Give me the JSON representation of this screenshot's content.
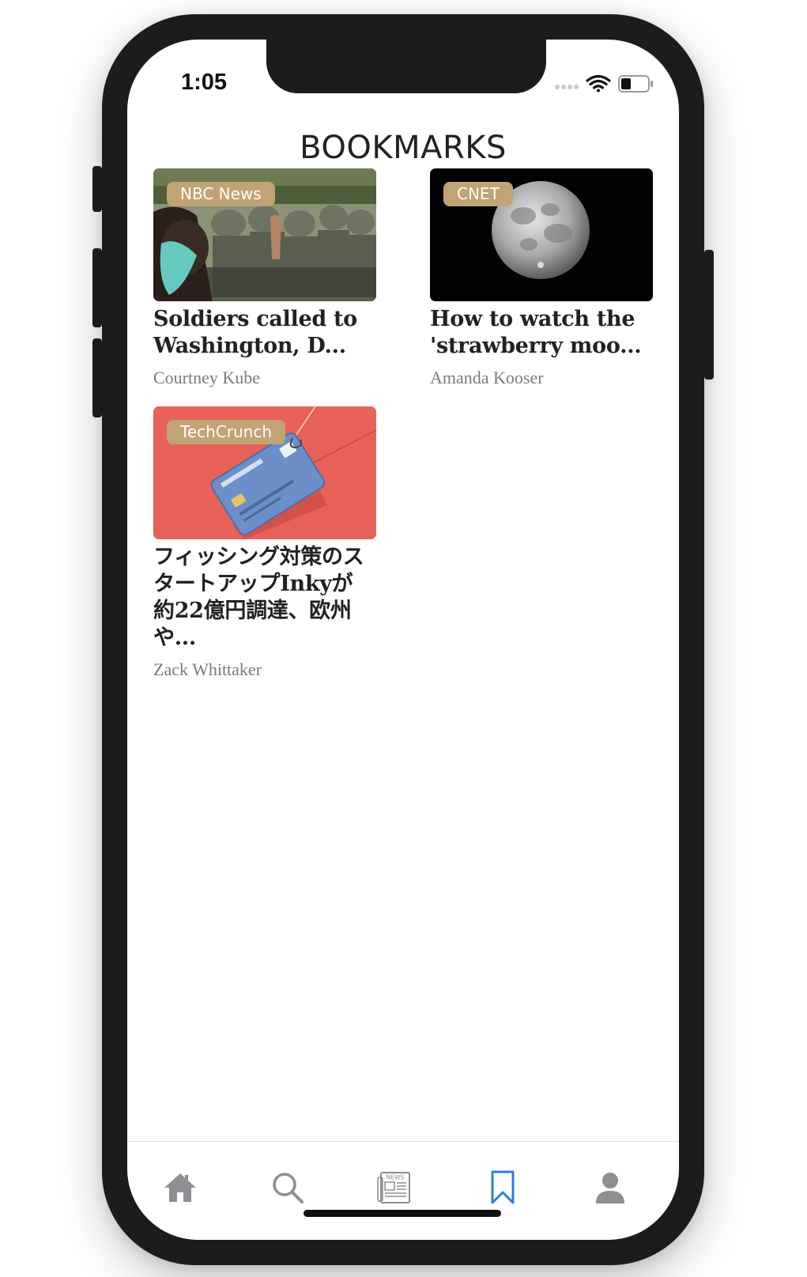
{
  "status_bar": {
    "time": "1:05"
  },
  "header": {
    "title": "BOOKMARKS"
  },
  "bookmarks": [
    {
      "source": "NBC News",
      "title": "Soldiers called to Washington, D...",
      "author": "Courtney Kube",
      "image": "protest-photo"
    },
    {
      "source": "CNET",
      "title": "How to watch the 'strawberry moo...",
      "author": "Amanda Kooser",
      "image": "moon-photo"
    },
    {
      "source": "TechCrunch",
      "title": "フィッシング対策のスタートアップInkyが約22億円調達、欧州や...",
      "author": "Zack Whittaker",
      "image": "credit-card-on-hook-illustration"
    }
  ],
  "tabbar": {
    "items": [
      {
        "name": "home",
        "icon": "home-icon",
        "active": false
      },
      {
        "name": "search",
        "icon": "search-icon",
        "active": false
      },
      {
        "name": "news",
        "icon": "newspaper-icon",
        "active": false
      },
      {
        "name": "bookmarks",
        "icon": "bookmark-icon",
        "active": true
      },
      {
        "name": "profile",
        "icon": "person-icon",
        "active": false
      }
    ],
    "news_icon_text": "NEWS"
  },
  "colors": {
    "badge": "#c1a375",
    "active_tab": "#2f7fd6",
    "inactive_tab": "#8e8e93",
    "title_text": "#222222",
    "author_text": "#7a7a7a",
    "techcrunch_bg": "#e8625a"
  }
}
